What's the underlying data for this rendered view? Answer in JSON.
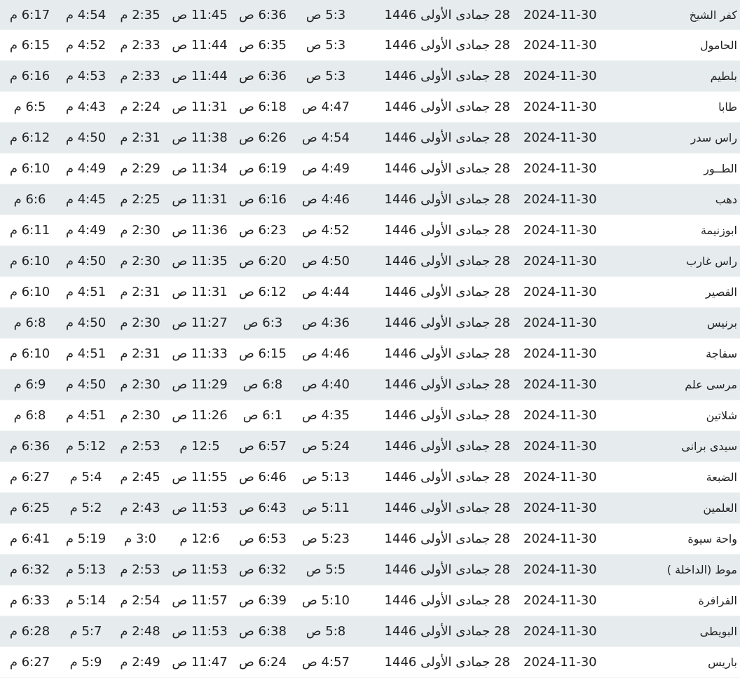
{
  "rows": [
    {
      "city": "كفر الشيخ",
      "gregorian": "2024-11-30",
      "hijri": "28 جمادى الأولى 1446",
      "fajr": "5:3 ص",
      "sunrise": "6:36 ص",
      "dhuhr": "11:45 ص",
      "asr": "2:35 م",
      "maghrib": "4:54 م",
      "isha": "6:17 م"
    },
    {
      "city": "الحامول",
      "gregorian": "2024-11-30",
      "hijri": "28 جمادى الأولى 1446",
      "fajr": "5:3 ص",
      "sunrise": "6:35 ص",
      "dhuhr": "11:44 ص",
      "asr": "2:33 م",
      "maghrib": "4:52 م",
      "isha": "6:15 م"
    },
    {
      "city": "بلطيم",
      "gregorian": "2024-11-30",
      "hijri": "28 جمادى الأولى 1446",
      "fajr": "5:3 ص",
      "sunrise": "6:36 ص",
      "dhuhr": "11:44 ص",
      "asr": "2:33 م",
      "maghrib": "4:53 م",
      "isha": "6:16 م"
    },
    {
      "city": "طابا",
      "gregorian": "2024-11-30",
      "hijri": "28 جمادى الأولى 1446",
      "fajr": "4:47 ص",
      "sunrise": "6:18 ص",
      "dhuhr": "11:31 ص",
      "asr": "2:24 م",
      "maghrib": "4:43 م",
      "isha": "6:5 م"
    },
    {
      "city": "راس سدر",
      "gregorian": "2024-11-30",
      "hijri": "28 جمادى الأولى 1446",
      "fajr": "4:54 ص",
      "sunrise": "6:26 ص",
      "dhuhr": "11:38 ص",
      "asr": "2:31 م",
      "maghrib": "4:50 م",
      "isha": "6:12 م"
    },
    {
      "city": "الطــور",
      "gregorian": "2024-11-30",
      "hijri": "28 جمادى الأولى 1446",
      "fajr": "4:49 ص",
      "sunrise": "6:19 ص",
      "dhuhr": "11:34 ص",
      "asr": "2:29 م",
      "maghrib": "4:49 م",
      "isha": "6:10 م"
    },
    {
      "city": "دهب",
      "gregorian": "2024-11-30",
      "hijri": "28 جمادى الأولى 1446",
      "fajr": "4:46 ص",
      "sunrise": "6:16 ص",
      "dhuhr": "11:31 ص",
      "asr": "2:25 م",
      "maghrib": "4:45 م",
      "isha": "6:6 م"
    },
    {
      "city": "ابوزنيمة",
      "gregorian": "2024-11-30",
      "hijri": "28 جمادى الأولى 1446",
      "fajr": "4:52 ص",
      "sunrise": "6:23 ص",
      "dhuhr": "11:36 ص",
      "asr": "2:30 م",
      "maghrib": "4:49 م",
      "isha": "6:11 م"
    },
    {
      "city": "راس غارب",
      "gregorian": "2024-11-30",
      "hijri": "28 جمادى الأولى 1446",
      "fajr": "4:50 ص",
      "sunrise": "6:20 ص",
      "dhuhr": "11:35 ص",
      "asr": "2:30 م",
      "maghrib": "4:50 م",
      "isha": "6:10 م"
    },
    {
      "city": "القصير",
      "gregorian": "2024-11-30",
      "hijri": "28 جمادى الأولى 1446",
      "fajr": "4:44 ص",
      "sunrise": "6:12 ص",
      "dhuhr": "11:31 ص",
      "asr": "2:31 م",
      "maghrib": "4:51 م",
      "isha": "6:10 م"
    },
    {
      "city": "برنيس",
      "gregorian": "2024-11-30",
      "hijri": "28 جمادى الأولى 1446",
      "fajr": "4:36 ص",
      "sunrise": "6:3 ص",
      "dhuhr": "11:27 ص",
      "asr": "2:30 م",
      "maghrib": "4:50 م",
      "isha": "6:8 م"
    },
    {
      "city": "سفاجة",
      "gregorian": "2024-11-30",
      "hijri": "28 جمادى الأولى 1446",
      "fajr": "4:46 ص",
      "sunrise": "6:15 ص",
      "dhuhr": "11:33 ص",
      "asr": "2:31 م",
      "maghrib": "4:51 م",
      "isha": "6:10 م"
    },
    {
      "city": "مرسى علم",
      "gregorian": "2024-11-30",
      "hijri": "28 جمادى الأولى 1446",
      "fajr": "4:40 ص",
      "sunrise": "6:8 ص",
      "dhuhr": "11:29 ص",
      "asr": "2:30 م",
      "maghrib": "4:50 م",
      "isha": "6:9 م"
    },
    {
      "city": "شلاتين",
      "gregorian": "2024-11-30",
      "hijri": "28 جمادى الأولى 1446",
      "fajr": "4:35 ص",
      "sunrise": "6:1 ص",
      "dhuhr": "11:26 ص",
      "asr": "2:30 م",
      "maghrib": "4:51 م",
      "isha": "6:8 م"
    },
    {
      "city": "سيدى برانى",
      "gregorian": "2024-11-30",
      "hijri": "28 جمادى الأولى 1446",
      "fajr": "5:24 ص",
      "sunrise": "6:57 ص",
      "dhuhr": "12:5 م",
      "asr": "2:53 م",
      "maghrib": "5:12 م",
      "isha": "6:36 م"
    },
    {
      "city": "الضبعة",
      "gregorian": "2024-11-30",
      "hijri": "28 جمادى الأولى 1446",
      "fajr": "5:13 ص",
      "sunrise": "6:46 ص",
      "dhuhr": "11:55 ص",
      "asr": "2:45 م",
      "maghrib": "5:4 م",
      "isha": "6:27 م"
    },
    {
      "city": "العلمين",
      "gregorian": "2024-11-30",
      "hijri": "28 جمادى الأولى 1446",
      "fajr": "5:11 ص",
      "sunrise": "6:43 ص",
      "dhuhr": "11:53 ص",
      "asr": "2:43 م",
      "maghrib": "5:2 م",
      "isha": "6:25 م"
    },
    {
      "city": "واحة سيوة",
      "gregorian": "2024-11-30",
      "hijri": "28 جمادى الأولى 1446",
      "fajr": "5:23 ص",
      "sunrise": "6:53 ص",
      "dhuhr": "12:6 م",
      "asr": "3:0 م",
      "maghrib": "5:19 م",
      "isha": "6:41 م"
    },
    {
      "city": "موط (الداخلة )",
      "gregorian": "2024-11-30",
      "hijri": "28 جمادى الأولى 1446",
      "fajr": "5:5 ص",
      "sunrise": "6:32 ص",
      "dhuhr": "11:53 ص",
      "asr": "2:53 م",
      "maghrib": "5:13 م",
      "isha": "6:32 م"
    },
    {
      "city": "الفرافرة",
      "gregorian": "2024-11-30",
      "hijri": "28 جمادى الأولى 1446",
      "fajr": "5:10 ص",
      "sunrise": "6:39 ص",
      "dhuhr": "11:57 ص",
      "asr": "2:54 م",
      "maghrib": "5:14 م",
      "isha": "6:33 م"
    },
    {
      "city": "البويطى",
      "gregorian": "2024-11-30",
      "hijri": "28 جمادى الأولى 1446",
      "fajr": "5:8 ص",
      "sunrise": "6:38 ص",
      "dhuhr": "11:53 ص",
      "asr": "2:48 م",
      "maghrib": "5:7 م",
      "isha": "6:28 م"
    },
    {
      "city": "باريس",
      "gregorian": "2024-11-30",
      "hijri": "28 جمادى الأولى 1446",
      "fajr": "4:57 ص",
      "sunrise": "6:24 ص",
      "dhuhr": "11:47 ص",
      "asr": "2:49 م",
      "maghrib": "5:9 م",
      "isha": "6:27 م"
    }
  ]
}
